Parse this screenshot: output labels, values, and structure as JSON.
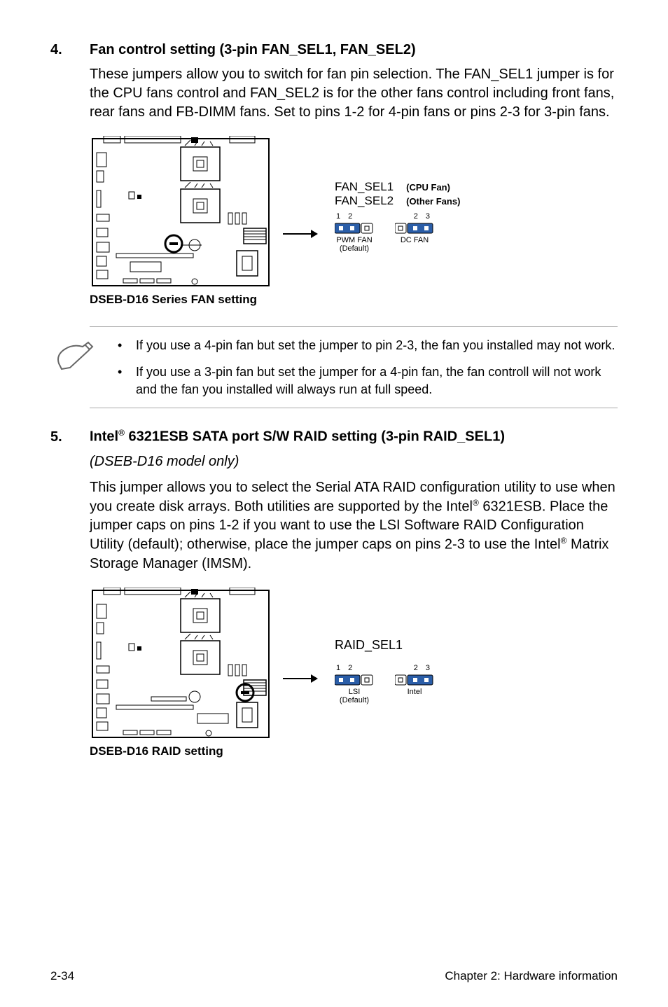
{
  "section4": {
    "number": "4.",
    "title": "Fan control setting (3-pin FAN_SEL1, FAN_SEL2)",
    "body": "These jumpers allow you to switch for fan pin selection. The FAN_SEL1 jumper is for the CPU fans control and FAN_SEL2 is for the other fans control including front fans, rear fans and FB-DIMM fans. Set to pins 1-2 for 4-pin fans or pins 2-3 for 3-pin fans.",
    "diagram_caption": "DSEB-D16 Series FAN setting",
    "jumper_label1": "FAN_SEL1",
    "jumper_label1_side": "(CPU Fan)",
    "jumper_label2": "FAN_SEL2",
    "jumper_label2_side": "(Other Fans)",
    "left_pins": "1  2",
    "right_pins": "2  3",
    "left_caption1": "PWM FAN",
    "left_caption2": "(Default)",
    "right_caption1": "DC FAN"
  },
  "notes": {
    "item1": "If you use a 4-pin fan but set the jumper to pin 2-3, the fan you installed may not work.",
    "item2": "If you use a 3-pin fan but set the jumper for a 4-pin fan, the fan controll will not work and the fan you installed will always run at full speed."
  },
  "section5": {
    "number": "5.",
    "title_prefix": "Intel",
    "title_rest": " 6321ESB SATA port S/W RAID setting (3-pin RAID_SEL1)",
    "subtitle": "(DSEB-D16 model only)",
    "body_part1": "This jumper allows you to select the Serial ATA RAID configuration utility to use when you create disk arrays. Both utilities are supported by the Intel",
    "body_part2": " 6321ESB. Place the jumper caps on pins 1-2 if you want to use the LSI Software RAID Configuration Utility (default); otherwise, place the jumper caps on pins 2-3 to use the Intel",
    "body_part3": " Matrix Storage Manager (IMSM).",
    "diagram_caption": "DSEB-D16 RAID setting",
    "jumper_label": "RAID_SEL1",
    "left_pins": "1  2",
    "right_pins": "2  3",
    "left_caption1": "LSI",
    "left_caption2": "(Default)",
    "right_caption1": "Intel"
  },
  "footer": {
    "left": "2-34",
    "right": "Chapter 2: Hardware information"
  }
}
